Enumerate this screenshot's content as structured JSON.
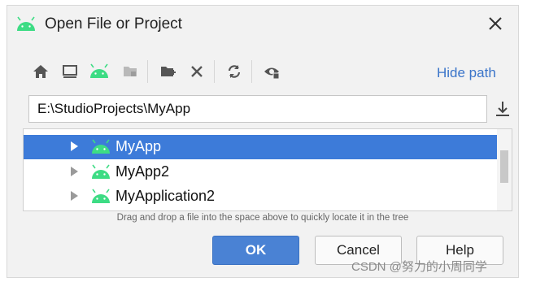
{
  "dialog": {
    "title": "Open File or Project",
    "icon": "android-icon",
    "close_icon": "close-icon"
  },
  "toolbar": {
    "buttons": [
      {
        "name": "home-icon"
      },
      {
        "name": "desktop-icon"
      },
      {
        "name": "android-project-icon"
      },
      {
        "name": "module-folder-icon"
      },
      {
        "name": "new-folder-icon"
      },
      {
        "name": "delete-icon"
      },
      {
        "name": "refresh-icon"
      },
      {
        "name": "show-hidden-files-icon"
      }
    ],
    "hide_path_label": "Hide path"
  },
  "path": {
    "value": "E:\\StudioProjects\\MyApp"
  },
  "tree": {
    "items": [
      {
        "label": "MyApp",
        "selected": true
      },
      {
        "label": "MyApp2",
        "selected": false
      },
      {
        "label": "MyApplication2",
        "selected": false
      }
    ]
  },
  "hint": "Drag and drop a file into the space above to quickly locate it in the tree",
  "buttons": {
    "ok": "OK",
    "cancel": "Cancel",
    "help": "Help"
  },
  "watermark": "CSDN @努力的小周同学",
  "colors": {
    "accent": "#3d7bd9",
    "android_green": "#3ddc84",
    "link": "#3a74c9"
  }
}
